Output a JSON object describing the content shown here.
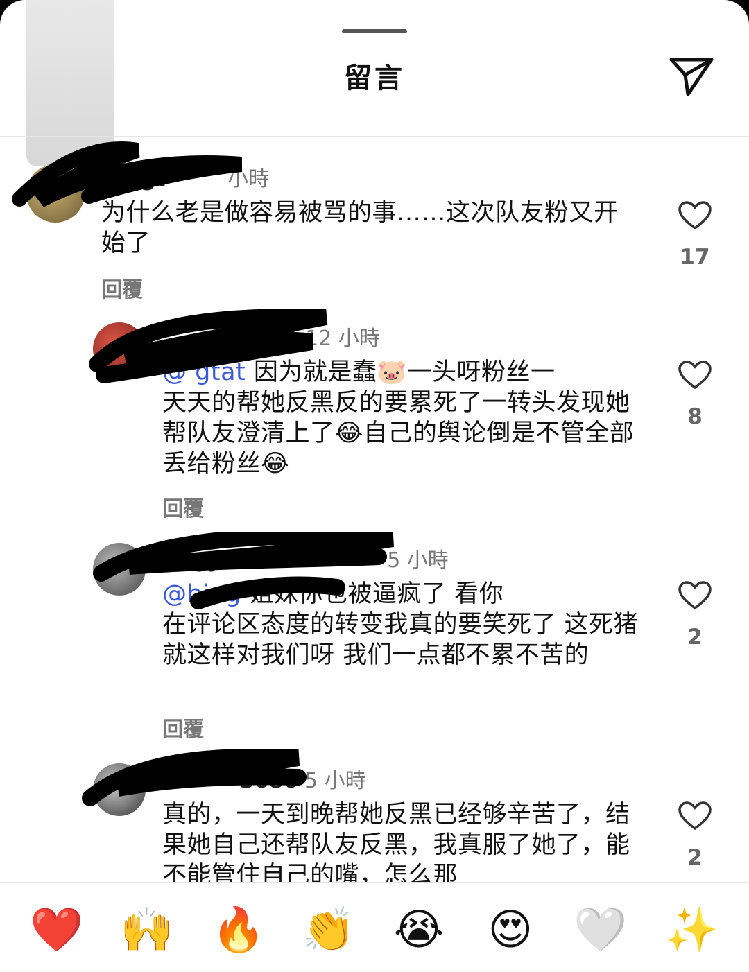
{
  "header": {
    "title": "留言"
  },
  "comments": [
    {
      "username": "rongt",
      "time": "小時",
      "text": "为什么老是做容易被骂的事……这次队友粉又开始了",
      "reply_label": "回覆",
      "likes": "17"
    },
    {
      "username": "at",
      "time": "12 小時",
      "mention": "@ gtat",
      "text_line1": " 因为就是蠢🐷一头呀粉丝一",
      "text_rest": "天天的帮她反黑反的要累死了一转头发现她帮队友澄清上了😂自己的舆论倒是不管全部丢给粉丝😂",
      "reply_label": "回覆",
      "likes": "8"
    },
    {
      "username": "angy",
      "time": "5 小時",
      "mention": "@hing",
      "text_line1": " 姐妹你也被逼疯了 看你",
      "text_rest": "在评论区态度的转变我真的要笑死了 这死猪就这样对我们呀 我们一点都不累不苦的",
      "reply_label": "回覆",
      "likes": "2"
    },
    {
      "username": "3086",
      "time": "5 小時",
      "text": "真的，一天到晚帮她反黑已经够辛苦了，结果她自己还帮队友反黑，我真服了她了，能不能管住自己的嘴，怎么那",
      "likes": "2"
    }
  ],
  "reactions": [
    "❤️",
    "🙌",
    "🔥",
    "👏",
    "😭",
    "😍",
    "🤍",
    "✨"
  ],
  "colors": {
    "mention": "#3b5bd6",
    "muted": "#777777",
    "like_outline": "#333333"
  }
}
